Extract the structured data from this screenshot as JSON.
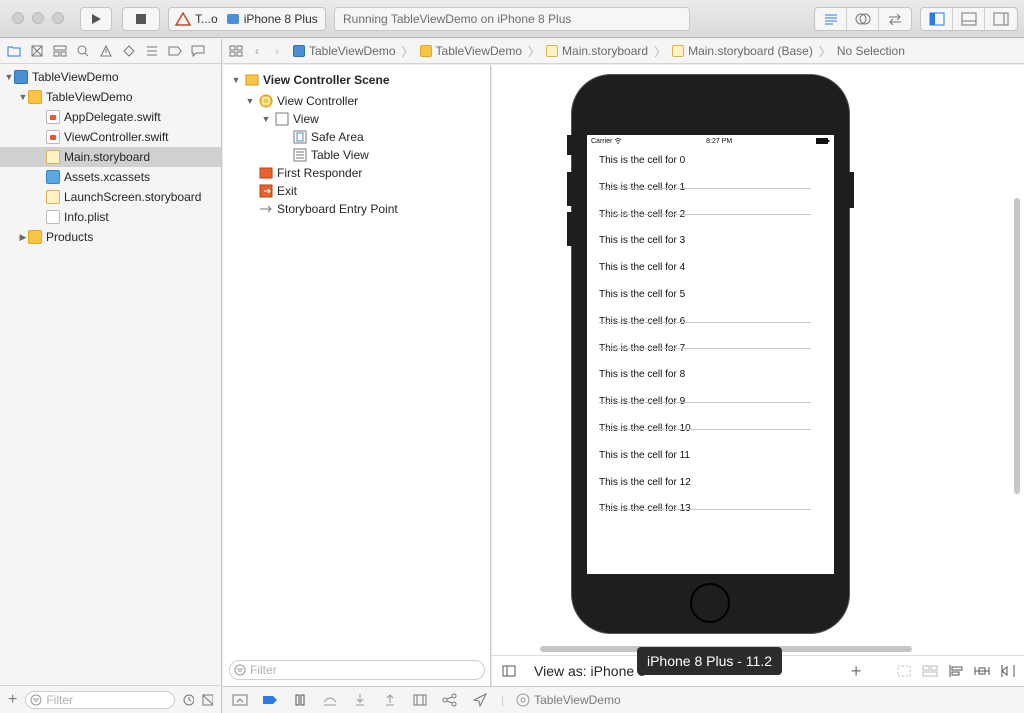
{
  "toolbar": {
    "scheme_name": "T...o",
    "device_name": "iPhone 8 Plus",
    "status_text": "Running TableViewDemo on iPhone 8 Plus"
  },
  "navigator": {
    "items": [
      {
        "label": "TableViewDemo",
        "kind": "project"
      },
      {
        "label": "TableViewDemo",
        "kind": "folder"
      },
      {
        "label": "AppDelegate.swift",
        "kind": "swift"
      },
      {
        "label": "ViewController.swift",
        "kind": "swift"
      },
      {
        "label": "Main.storyboard",
        "kind": "storyboard",
        "selected": true
      },
      {
        "label": "Assets.xcassets",
        "kind": "assets"
      },
      {
        "label": "LaunchScreen.storyboard",
        "kind": "storyboard"
      },
      {
        "label": "Info.plist",
        "kind": "plist"
      },
      {
        "label": "Products",
        "kind": "folder"
      }
    ],
    "filter_placeholder": "Filter"
  },
  "jumpbar": {
    "crumbs": [
      "TableViewDemo",
      "TableViewDemo",
      "Main.storyboard",
      "Main.storyboard (Base)",
      "No Selection"
    ]
  },
  "outline": {
    "scene_title": "View Controller Scene",
    "items": [
      {
        "label": "View Controller"
      },
      {
        "label": "View"
      },
      {
        "label": "Safe Area"
      },
      {
        "label": "Table View"
      },
      {
        "label": "First Responder"
      },
      {
        "label": "Exit"
      },
      {
        "label": "Storyboard Entry Point"
      }
    ],
    "filter_placeholder": "Filter"
  },
  "simulator": {
    "carrier": "Carrier",
    "time": "8:27 PM",
    "cells": [
      "This is the cell for 0",
      "This is the cell for 1",
      "This is the cell for 2",
      "This is the cell for 3",
      "This is the cell for 4",
      "This is the cell for 5",
      "This is the cell for 6",
      "This is the cell for 7",
      "This is the cell for 8",
      "This is the cell for 9",
      "This is the cell for 10",
      "This is the cell for 11",
      "This is the cell for 12",
      "This is the cell for 13"
    ]
  },
  "canvas_bar": {
    "view_as_label": "View as: iPhone 8",
    "tooltip": "iPhone 8 Plus - 11.2"
  },
  "debugbar": {
    "target_label": "TableViewDemo"
  },
  "colors": {
    "accent": "#2a7be4",
    "folder": "#f8c545",
    "selection": "#d0d0d0"
  }
}
